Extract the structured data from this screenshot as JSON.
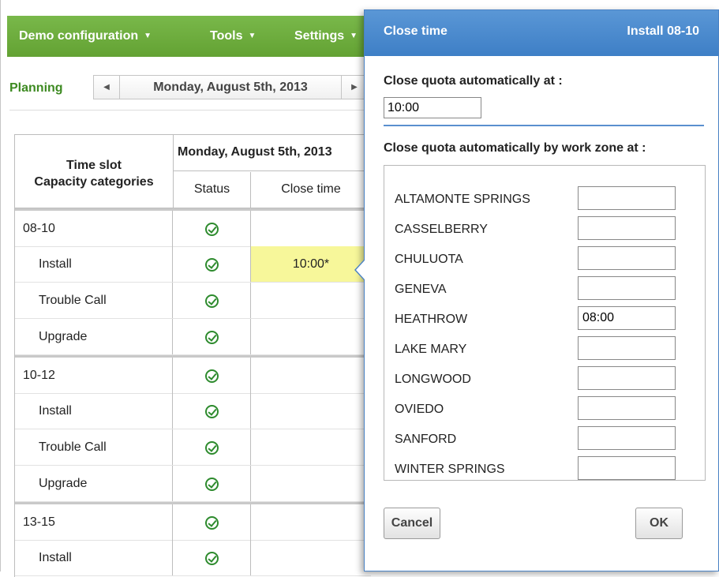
{
  "menubar": {
    "items": [
      {
        "label": "Demo configuration"
      },
      {
        "label": "Tools"
      },
      {
        "label": "Settings"
      }
    ]
  },
  "nav": {
    "section": "Planning",
    "date": "Monday, August 5th, 2013"
  },
  "grid": {
    "head_timeslot_line1": "Time slot",
    "head_timeslot_line2": "Capacity categories",
    "head_day": "Monday, August 5th, 2013",
    "head_status": "Status",
    "head_close": "Close time",
    "rows": [
      {
        "label": "08-10",
        "group": true,
        "close": ""
      },
      {
        "label": "Install",
        "group": false,
        "close": "10:00*"
      },
      {
        "label": "Trouble Call",
        "group": false,
        "close": ""
      },
      {
        "label": "Upgrade",
        "group": false,
        "close": ""
      },
      {
        "label": "10-12",
        "group": true,
        "close": ""
      },
      {
        "label": "Install",
        "group": false,
        "close": ""
      },
      {
        "label": "Trouble Call",
        "group": false,
        "close": ""
      },
      {
        "label": "Upgrade",
        "group": false,
        "close": ""
      },
      {
        "label": "13-15",
        "group": true,
        "close": ""
      },
      {
        "label": "Install",
        "group": false,
        "close": ""
      }
    ]
  },
  "popup": {
    "title": "Close time",
    "subtitle": "Install 08-10",
    "label_auto": "Close quota automatically at :",
    "auto_value": "10:00",
    "label_zone": "Close quota automatically by work zone at :",
    "zones": [
      {
        "name": "ALTAMONTE SPRINGS",
        "value": ""
      },
      {
        "name": "CASSELBERRY",
        "value": ""
      },
      {
        "name": "CHULUOTA",
        "value": ""
      },
      {
        "name": "GENEVA",
        "value": ""
      },
      {
        "name": "HEATHROW",
        "value": "08:00"
      },
      {
        "name": "LAKE MARY",
        "value": ""
      },
      {
        "name": "LONGWOOD",
        "value": ""
      },
      {
        "name": "OVIEDO",
        "value": ""
      },
      {
        "name": "SANFORD",
        "value": ""
      },
      {
        "name": "WINTER SPRINGS",
        "value": ""
      }
    ],
    "cancel_label": "Cancel",
    "ok_label": "OK"
  },
  "colors": {
    "menubar": "#6aaa3a",
    "planning": "#3d8a21",
    "popup_header": "#4a87cc",
    "highlight": "#f7f79a",
    "status_ok": "#2e8b2e",
    "triangle": "#f0a23c"
  },
  "icons": {
    "status": "check-circle-icon",
    "menu_caret": "caret-down-icon",
    "nav_prev": "triangle-left-icon",
    "nav_next": "triangle-right-icon"
  }
}
